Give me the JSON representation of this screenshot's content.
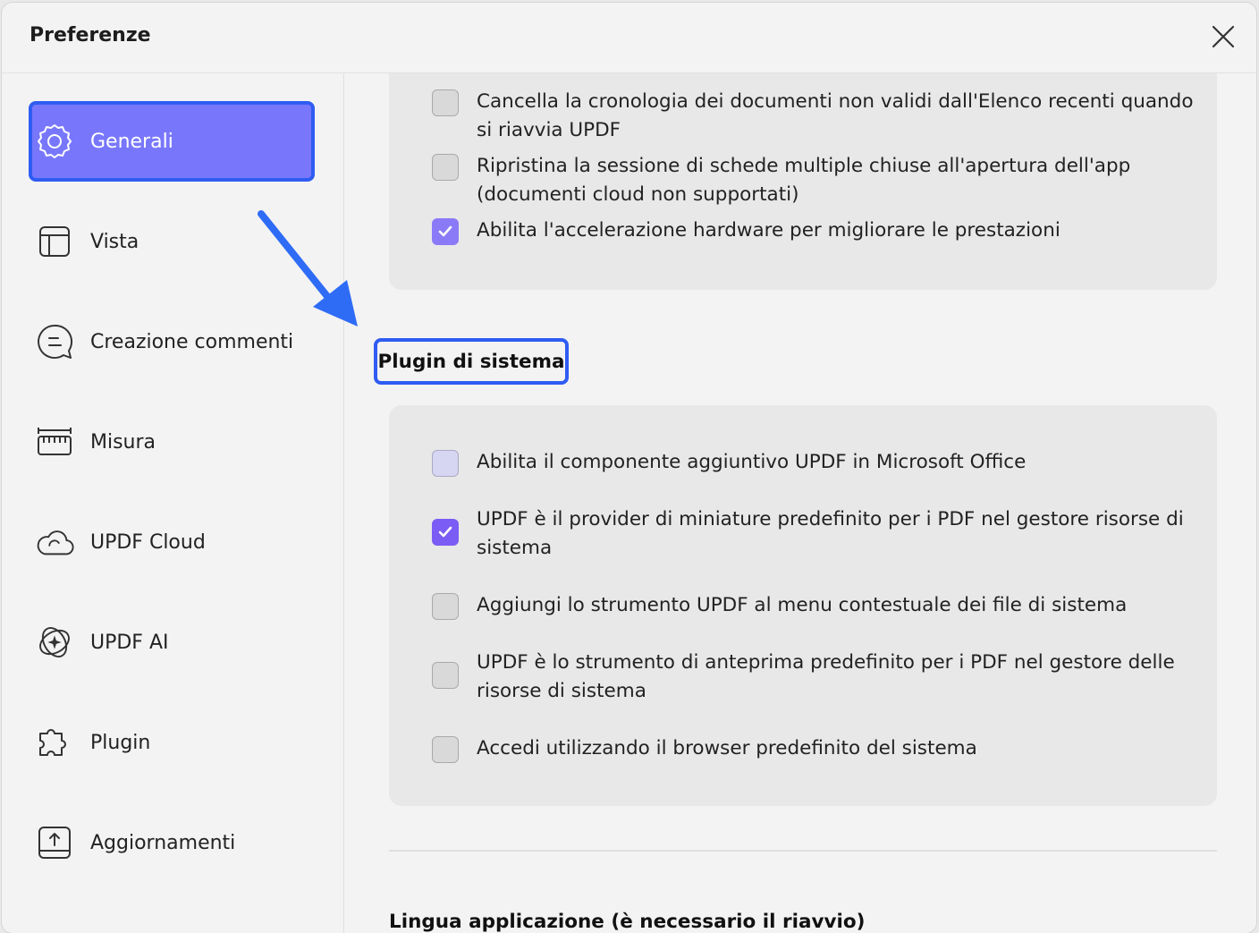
{
  "window": {
    "title": "Preferenze"
  },
  "sidebar": {
    "items": [
      {
        "label": "Generali",
        "icon": "gear-icon",
        "active": true
      },
      {
        "label": "Vista",
        "icon": "layout-icon",
        "active": false
      },
      {
        "label": "Creazione commenti",
        "icon": "comment-icon",
        "active": false
      },
      {
        "label": "Misura",
        "icon": "ruler-icon",
        "active": false
      },
      {
        "label": "UPDF Cloud",
        "icon": "cloud-icon",
        "active": false
      },
      {
        "label": "UPDF AI",
        "icon": "ai-sparkle-icon",
        "active": false
      },
      {
        "label": "Plugin",
        "icon": "puzzle-icon",
        "active": false
      },
      {
        "label": "Aggiornamenti",
        "icon": "update-icon",
        "active": false
      }
    ]
  },
  "general_options": [
    {
      "label": "Cancella la cronologia dei documenti non validi dall'Elenco recenti quando si riavvia UPDF",
      "checked": false
    },
    {
      "label": "Ripristina la sessione di schede multiple chiuse all'apertura dell'app (documenti cloud non supportati)",
      "checked": false
    },
    {
      "label": "Abilita l'accelerazione hardware per migliorare le prestazioni",
      "checked": true
    }
  ],
  "system_plugins": {
    "title": "Plugin di sistema",
    "options": [
      {
        "label": "Abilita il componente aggiuntivo UPDF in Microsoft Office",
        "checked": false
      },
      {
        "label": "UPDF è il provider di miniature predefinito per i PDF nel gestore risorse di sistema",
        "checked": true
      },
      {
        "label": "Aggiungi lo strumento UPDF al menu contestuale dei file di sistema",
        "checked": false
      },
      {
        "label": "UPDF è lo strumento di anteprima predefinito per i PDF nel gestore delle risorse di sistema",
        "checked": false
      },
      {
        "label": "Accedi utilizzando il browser predefinito del sistema",
        "checked": false
      }
    ]
  },
  "language_section": {
    "title": "Lingua applicazione (è necessario il riavvio)"
  },
  "colors": {
    "accent": "#7b5cf5",
    "active_nav": "#7877fb",
    "highlight_border": "#2f5cf2"
  }
}
